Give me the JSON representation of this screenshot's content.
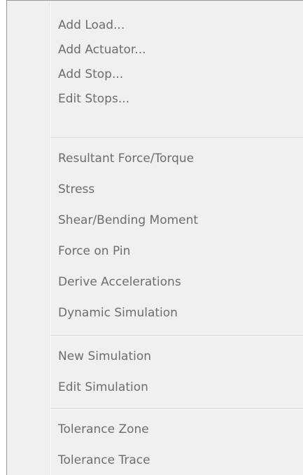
{
  "menu": {
    "group1": [
      "Add Load...",
      "Add Actuator...",
      "Add Stop...",
      "Edit Stops..."
    ],
    "group2": [
      "Resultant Force/Torque",
      "Stress",
      "Shear/Bending Moment",
      "Force on Pin",
      "Derive Accelerations",
      "Dynamic Simulation"
    ],
    "group3": [
      "New Simulation",
      "Edit Simulation"
    ],
    "group4": [
      "Tolerance Zone",
      "Tolerance Trace"
    ]
  },
  "colors": {
    "menu_background": "#f0f0f0",
    "disabled_text": "#6d6d6d",
    "border": "#979797"
  }
}
